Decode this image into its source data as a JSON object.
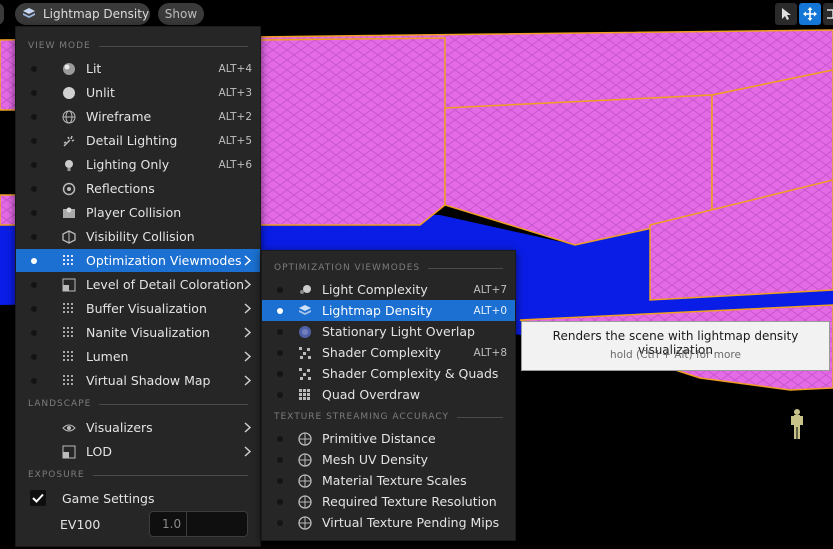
{
  "toolbar": {
    "view_mode_label": "Lightmap Density",
    "show_label": "Show"
  },
  "main_menu": {
    "sections": {
      "view_mode": "VIEW MODE",
      "landscape": "LANDSCAPE",
      "exposure": "EXPOSURE"
    },
    "items": [
      {
        "label": "Lit",
        "shortcut": "ALT+4",
        "icon": "lit-sphere-icon"
      },
      {
        "label": "Unlit",
        "shortcut": "ALT+3",
        "icon": "unlit-sphere-icon"
      },
      {
        "label": "Wireframe",
        "shortcut": "ALT+2",
        "icon": "wireframe-sphere-icon"
      },
      {
        "label": "Detail Lighting",
        "shortcut": "ALT+5",
        "icon": "detail-lighting-icon"
      },
      {
        "label": "Lighting Only",
        "shortcut": "ALT+6",
        "icon": "lightbulb-icon"
      },
      {
        "label": "Reflections",
        "shortcut": "",
        "icon": "reflections-icon"
      },
      {
        "label": "Player Collision",
        "shortcut": "",
        "icon": "player-collision-icon"
      },
      {
        "label": "Visibility Collision",
        "shortcut": "",
        "icon": "visibility-collision-icon"
      },
      {
        "label": "Optimization Viewmodes",
        "shortcut": "",
        "icon": "grid-icon"
      },
      {
        "label": "Level of Detail Coloration",
        "shortcut": "",
        "icon": "lod-coloration-icon"
      },
      {
        "label": "Buffer Visualization",
        "shortcut": "",
        "icon": "grid-icon"
      },
      {
        "label": "Nanite Visualization",
        "shortcut": "",
        "icon": "grid-icon"
      },
      {
        "label": "Lumen",
        "shortcut": "",
        "icon": "grid-icon"
      },
      {
        "label": "Virtual Shadow Map",
        "shortcut": "",
        "icon": "grid-icon"
      }
    ],
    "landscape_items": [
      {
        "label": "Visualizers",
        "icon": "eye-icon"
      },
      {
        "label": "LOD",
        "icon": "lod-icon"
      }
    ],
    "game_settings_label": "Game Settings",
    "ev100_label": "EV100",
    "ev100_value": "1.0"
  },
  "sub_menu": {
    "sections": {
      "optimization": "OPTIMIZATION VIEWMODES",
      "texture": "TEXTURE STREAMING ACCURACY"
    },
    "items": [
      {
        "label": "Light Complexity",
        "shortcut": "ALT+7"
      },
      {
        "label": "Lightmap Density",
        "shortcut": "ALT+0"
      },
      {
        "label": "Stationary Light Overlap",
        "shortcut": ""
      },
      {
        "label": "Shader Complexity",
        "shortcut": "ALT+8"
      },
      {
        "label": "Shader Complexity & Quads",
        "shortcut": ""
      },
      {
        "label": "Quad Overdraw",
        "shortcut": ""
      }
    ],
    "texture_items": [
      {
        "label": "Primitive Distance"
      },
      {
        "label": "Mesh UV Density"
      },
      {
        "label": "Material Texture Scales"
      },
      {
        "label": "Required Texture Resolution"
      },
      {
        "label": "Virtual Texture Pending Mips"
      }
    ]
  },
  "tooltip": {
    "text": "Renders the scene with lightmap density visualization",
    "hint": "hold (Ctrl + Alt) for more"
  },
  "colors": {
    "selection": "#1b70d1",
    "menu_bg": "#262626",
    "scene_blue": "#0a1de6",
    "scene_pink": "#e46ae6",
    "scene_edge": "#f0a020"
  }
}
